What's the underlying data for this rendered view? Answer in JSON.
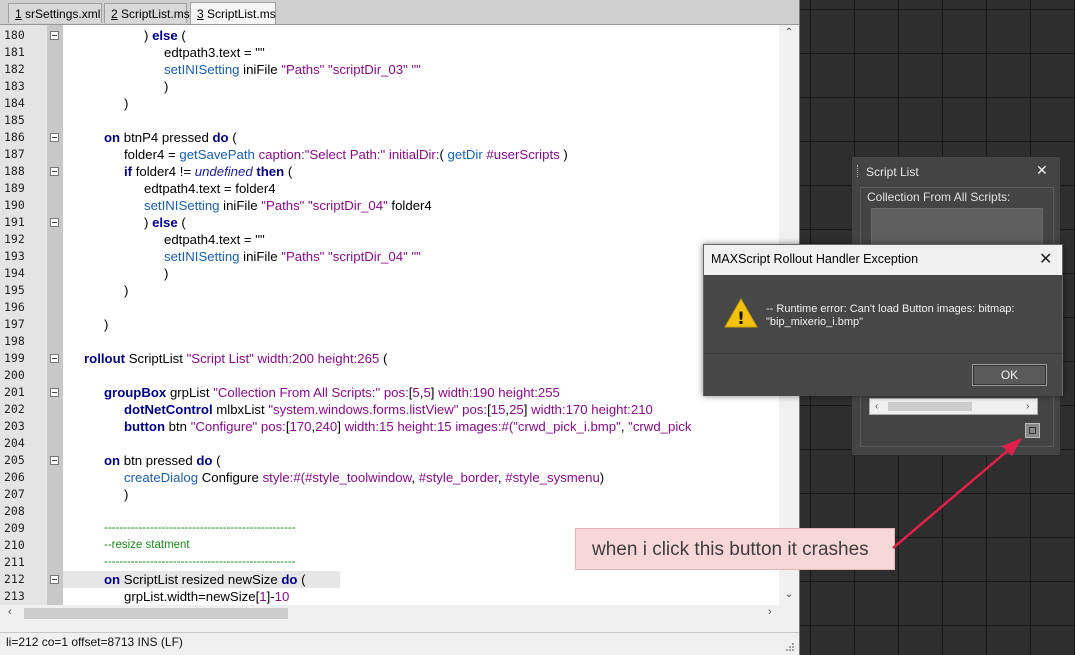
{
  "tabs": [
    {
      "key": "1",
      "label": " srSettings.xml"
    },
    {
      "key": "2",
      "label": " ScriptList.ms"
    },
    {
      "key": "3",
      "label": " ScriptList.ms"
    }
  ],
  "code_lines": [
    {
      "num": "180"
    },
    {
      "num": "181"
    },
    {
      "num": "182"
    },
    {
      "num": "183"
    },
    {
      "num": "184"
    },
    {
      "num": "185"
    },
    {
      "num": "186"
    },
    {
      "num": "187"
    },
    {
      "num": "188"
    },
    {
      "num": "189"
    },
    {
      "num": "190"
    },
    {
      "num": "191"
    },
    {
      "num": "192"
    },
    {
      "num": "193"
    },
    {
      "num": "194"
    },
    {
      "num": "195"
    },
    {
      "num": "196"
    },
    {
      "num": "197"
    },
    {
      "num": "198"
    },
    {
      "num": "199"
    },
    {
      "num": "200"
    },
    {
      "num": "201"
    },
    {
      "num": "202"
    },
    {
      "num": "203"
    },
    {
      "num": "204"
    },
    {
      "num": "205"
    },
    {
      "num": "206"
    },
    {
      "num": "207"
    },
    {
      "num": "208"
    },
    {
      "num": "209"
    },
    {
      "num": "210"
    },
    {
      "num": "211"
    },
    {
      "num": "212"
    },
    {
      "num": "213"
    }
  ],
  "code": {
    "l180": [
      ") ",
      "else",
      " ("
    ],
    "l181": "edtpath3.text = \"\"",
    "l182": [
      "setINISetting",
      " iniFile ",
      "\"Paths\"",
      " ",
      "\"scriptDir_03\"",
      " ",
      "\"\""
    ],
    "l183": ")",
    "l184": ")",
    "l186": [
      "on",
      " btnP4 pressed ",
      "do",
      " ("
    ],
    "l187": [
      "folder4 = ",
      "getSavePath",
      " ",
      "caption:",
      "\"Select Path:\"",
      " ",
      "initialDir:",
      "( ",
      "getDir",
      " ",
      "#userScripts",
      " )"
    ],
    "l188": [
      "if",
      " folder4 != ",
      "undefined",
      " ",
      "then",
      " ("
    ],
    "l189": "edtpath4.text = folder4",
    "l190": [
      "setINISetting",
      " iniFile ",
      "\"Paths\"",
      " ",
      "\"scriptDir_04\"",
      " folder4"
    ],
    "l191": [
      ") ",
      "else",
      " ("
    ],
    "l192": "edtpath4.text = \"\"",
    "l193": [
      "setINISetting",
      " iniFile ",
      "\"Paths\"",
      " ",
      "\"scriptDir_04\"",
      " ",
      "\"\""
    ],
    "l194": ")",
    "l195": ")",
    "l197": ")",
    "l199": [
      "rollout",
      " ScriptList ",
      "\"Script List\"",
      " ",
      "width:",
      "200",
      " ",
      "height:",
      "265",
      " ("
    ],
    "l201": [
      "groupBox",
      " grpList ",
      "\"Collection From All Scripts:\"",
      " ",
      "pos:",
      "[",
      "5",
      ",",
      "5",
      "]",
      " ",
      "width:",
      "190",
      " ",
      "height:",
      "255"
    ],
    "l202": [
      "dotNetControl",
      " mlbxList ",
      "\"system.windows.forms.listView\"",
      " ",
      "pos:",
      "[",
      "15",
      ",",
      "25",
      "]",
      " ",
      "width:",
      "170",
      " ",
      "height:",
      "210"
    ],
    "l203": [
      "button",
      " btn ",
      "\"Configure\"",
      " ",
      "pos:",
      "[",
      "170",
      ",",
      "240",
      "]",
      " ",
      "width:",
      "15",
      " ",
      "height:",
      "15",
      " ",
      "images:",
      "#(",
      "\"crwd_pick_i.bmp\"",
      ", ",
      "\"crwd_pick"
    ],
    "l205": [
      "on",
      " btn pressed ",
      "do",
      " ("
    ],
    "l206": [
      "createDialog",
      " Configure ",
      "style:",
      "#(",
      "#style_toolwindow",
      ", ",
      "#style_border",
      ", ",
      "#style_sysmenu",
      ")"
    ],
    "l207": ")",
    "l209": "--------------------------------------------------",
    "l210": "--resize statment",
    "l211": "--------------------------------------------------",
    "l212": [
      "on",
      " ScriptList resized newSize ",
      "do",
      " ("
    ],
    "l213": [
      "grpList.width=newSize[",
      "1",
      "]-",
      "10"
    ]
  },
  "status": "li=212 co=1 offset=8713 INS (LF)",
  "script_list": {
    "title": "Script List",
    "close": "✕",
    "group_label": "Collection From All Scripts:"
  },
  "dialog": {
    "title": "MAXScript Rollout Handler Exception",
    "close": "✕",
    "message_line1": "-- Runtime error: Can't load Button images: bitmap:",
    "message_line2": "\"bip_mixerio_i.bmp\"",
    "ok_label": "OK",
    "warning_glyph": "!"
  },
  "annotation": {
    "text": "when i click this button it crashes",
    "color": "#e0204a"
  },
  "colors": {
    "keyword": "#00008b",
    "function": "#1a5fb4",
    "string": "#8b0a8b",
    "comment": "#1a8a1a",
    "dialog_dark": "#474747",
    "warning_yellow": "#f4c20d"
  }
}
